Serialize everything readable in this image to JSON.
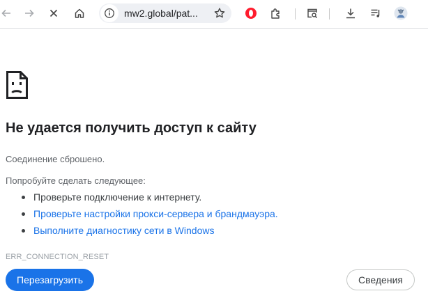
{
  "browser": {
    "url": "mw2.global/pat...",
    "icons": [
      "back-icon",
      "forward-icon",
      "stop-icon",
      "home-icon",
      "site-info-icon",
      "bookmark-star-icon",
      "opera-icon",
      "extensions-icon",
      "tab-search-icon",
      "downloads-icon",
      "media-control-icon",
      "profile-avatar-icon"
    ],
    "accent": "#1a73e8"
  },
  "error_page": {
    "title": "Не удается получить доступ к сайту",
    "status": "Соединение сброшено.",
    "try_label": "Попробуйте сделать следующее:",
    "suggestions": [
      "Проверьте подключение к интернету.",
      "Проверьте настройки прокси-сервера и брандмауэра.",
      "Выполните диагностику сети в Windows"
    ],
    "error_code": "ERR_CONNECTION_RESET",
    "reload_label": "Перезагрузить",
    "details_label": "Сведения",
    "icon": "sad-page-icon"
  }
}
